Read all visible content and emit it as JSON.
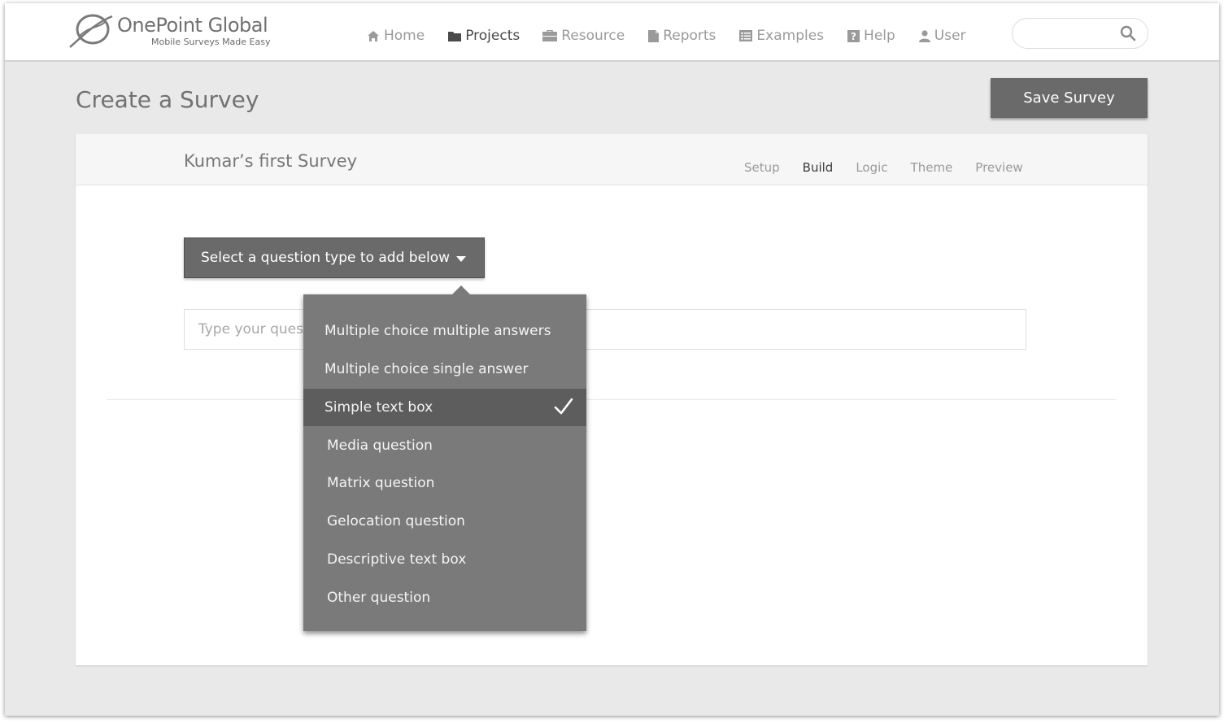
{
  "brand": {
    "name": "OnePoint Global",
    "tagline": "Mobile Surveys Made Easy"
  },
  "nav": {
    "items": [
      {
        "label": "Home",
        "icon": "home-icon"
      },
      {
        "label": "Projects",
        "icon": "folder-icon",
        "active": true
      },
      {
        "label": "Resource",
        "icon": "briefcase-icon"
      },
      {
        "label": "Reports",
        "icon": "document-icon"
      },
      {
        "label": "Examples",
        "icon": "list-icon"
      },
      {
        "label": "Help",
        "icon": "help-icon"
      },
      {
        "label": "User",
        "icon": "user-icon"
      }
    ],
    "search_placeholder": ""
  },
  "page": {
    "title": "Create a Survey",
    "save_label": "Save Survey"
  },
  "survey": {
    "name": "Kumar’s first Survey",
    "tabs": [
      {
        "label": "Setup"
      },
      {
        "label": "Build",
        "active": true
      },
      {
        "label": "Logic"
      },
      {
        "label": "Theme"
      },
      {
        "label": "Preview"
      }
    ]
  },
  "builder": {
    "question_type_label": "Select a question type to add below",
    "question_placeholder": "Type your question here",
    "menu": {
      "items": [
        {
          "label": "Multiple choice multiple answers"
        },
        {
          "label": "Multiple choice single answer"
        },
        {
          "label": "Simple text box",
          "selected": true
        },
        {
          "label": "Media question"
        },
        {
          "label": "Matrix question"
        },
        {
          "label": "Gelocation question"
        },
        {
          "label": "Descriptive text box"
        },
        {
          "label": "Other question"
        }
      ]
    }
  },
  "colors": {
    "accent_dark": "#6a6a6a",
    "menu_bg": "#7a7a7a",
    "menu_selected": "#5d5d5d"
  }
}
